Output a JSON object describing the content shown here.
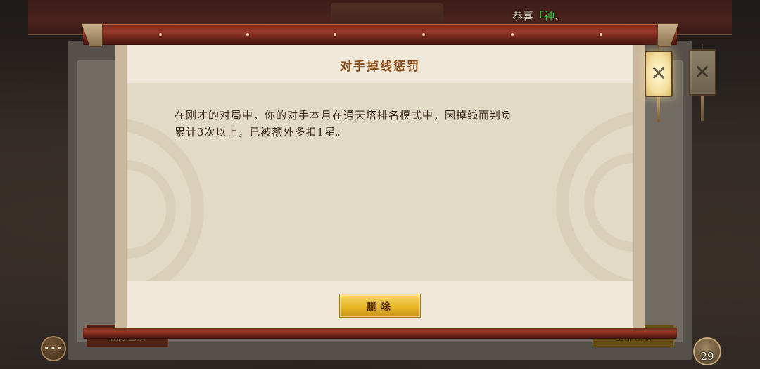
{
  "background": {
    "congrats_prefix": "恭喜",
    "congrats_bracket": "「",
    "congrats_name": "神",
    "congrats_suffix": "、",
    "left_button_label": "删除已读",
    "right_button_label": "全部领取",
    "level": "29"
  },
  "dialog": {
    "title": "对手掉线惩罚",
    "message_line1": "在刚才的对局中，你的对手本月在通天塔排名模式中，因掉线而判负",
    "message_line2": "累计3次以上，已被额外多扣1星。",
    "delete_label": "删除"
  },
  "icons": {
    "close": "close-icon",
    "chat": "chat-bubble-icon"
  },
  "colors": {
    "title": "#8a4a14",
    "button_gold": "#e8b828",
    "scroll_red": "#7a2a20",
    "highlight_green": "#4ad04a"
  }
}
